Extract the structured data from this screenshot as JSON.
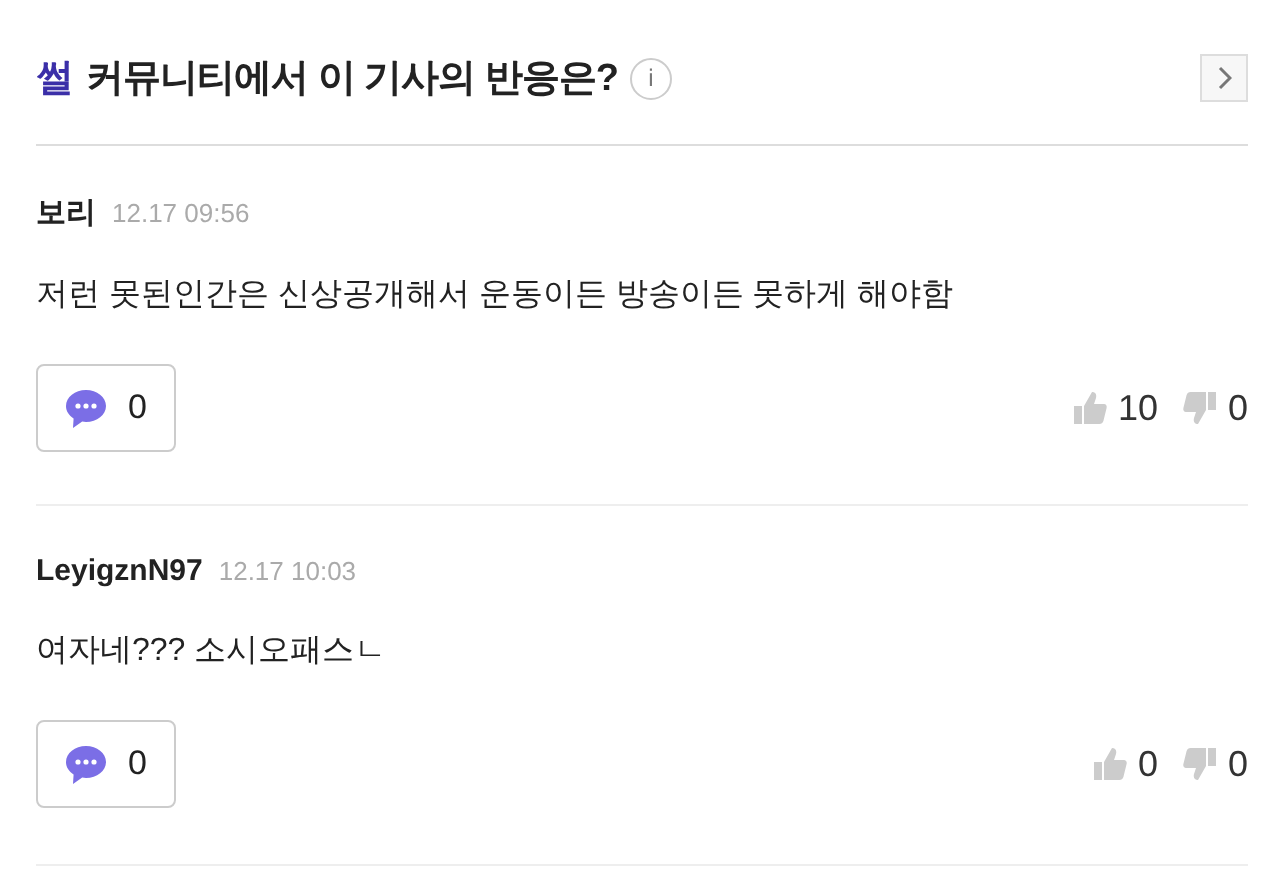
{
  "header": {
    "brand": "썰",
    "title": "커뮤니티에서 이 기사의 반응은?",
    "info": "i"
  },
  "comments": [
    {
      "author": "보리",
      "time": "12.17 09:56",
      "text": "저런 못된인간은 신상공개해서 운동이든 방송이든 못하게 해야함",
      "replies": "0",
      "likes": "10",
      "dislikes": "0"
    },
    {
      "author": "LeyigznN97",
      "time": "12.17 10:03",
      "text": "여자네??? 소시오패스ㄴ",
      "replies": "0",
      "likes": "0",
      "dislikes": "0"
    }
  ]
}
